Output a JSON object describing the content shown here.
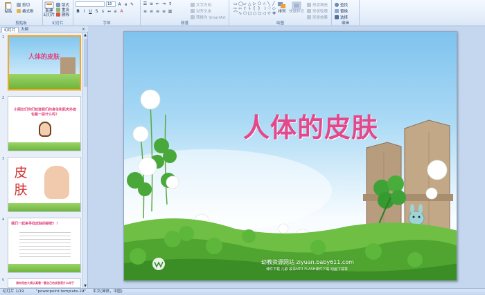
{
  "ribbon": {
    "clipboard": {
      "label": "剪贴板",
      "paste": "粘贴",
      "cut": "剪切",
      "copy": "复制",
      "format_painter": "格式刷"
    },
    "slides": {
      "label": "幻灯片",
      "new_slide": "新建\n幻灯片",
      "layout": "版式",
      "reset": "重设",
      "delete": "删除"
    },
    "font": {
      "label": "字体",
      "font_name": "",
      "font_size": "18"
    },
    "paragraph": {
      "label": "段落",
      "text_direction": "文字方向",
      "align_text": "对齐文本",
      "smartart": "转换为 SmartArt"
    },
    "drawing": {
      "label": "绘图",
      "arrange": "排列",
      "quick_styles": "快速样式",
      "shape_fill": "形状填充",
      "shape_outline": "形状轮廓",
      "shape_effects": "形状效果"
    },
    "editing": {
      "label": "编辑",
      "find": "查找",
      "replace": "替换",
      "select": "选择"
    }
  },
  "panel": {
    "tab_slides": "幻灯片",
    "tab_outline": "大纲",
    "close": "×",
    "thumbnails": [
      {
        "number": "1",
        "text": "人体的皮肤"
      },
      {
        "number": "2",
        "text": "小朋友们你们知道我们的身体和肌肉外面包着一层什么吗？"
      },
      {
        "number": "3",
        "text": "皮肤"
      },
      {
        "number": "4",
        "text": "我们一起来寻找皮肤的秘密！！"
      },
      {
        "number": "5",
        "text": "请你用放大镜认真看一看自己的皮肤是什么样子"
      }
    ]
  },
  "slide": {
    "title": "人体的皮肤",
    "site": "幼教资源网站 ziyuan.baby611.com",
    "links": "课件下载  儿歌  故事MP3  FLASH课件下载  动画下载等"
  },
  "status": {
    "slide_info": "幻灯片 1/19",
    "theme": "\"powerpoint-template-24\"",
    "language": "中文(简体，中国)"
  },
  "colors": {
    "title_pink": "#e4478a",
    "ribbon_bg": "#dce8f7",
    "selection": "#f5a623"
  }
}
